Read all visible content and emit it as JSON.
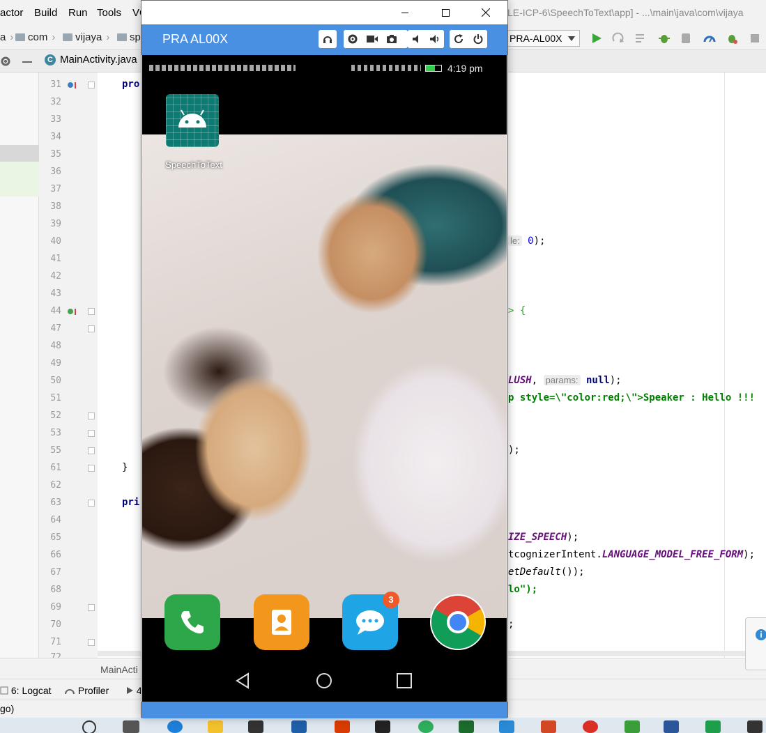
{
  "ide": {
    "menu": [
      "actor",
      "Build",
      "Run",
      "Tools",
      "VC"
    ],
    "title_fragment": "LE-ICP-6\\SpeechToText\\app] - ...\\main\\java\\com\\vijaya",
    "breadcrumb": [
      "a",
      "com",
      "vijaya",
      "sp"
    ],
    "device_selector": "PRA-AL00X",
    "file_tab": "MainActivity.java",
    "bottom_tab": "MainActi",
    "tool_windows": [
      "6: Logcat",
      "Profiler",
      "4"
    ],
    "status_text": "go)",
    "line_numbers": [
      "31",
      "32",
      "33",
      "34",
      "35",
      "36",
      "37",
      "38",
      "39",
      "40",
      "41",
      "42",
      "43",
      "44",
      "47",
      "48",
      "49",
      "50",
      "51",
      "52",
      "53",
      "55",
      "61",
      "62",
      "63",
      "64",
      "65",
      "66",
      "67",
      "68",
      "69",
      "70",
      "71",
      "72"
    ],
    "code": {
      "l31": "pro",
      "l40_hint": "le:",
      "l40_val": "0",
      "l40_end": ");",
      "l44": "> {",
      "l50_const": "LUSH",
      "l50_hint": "params:",
      "l50_null": "null",
      "l50_end": ");",
      "l51": "p style=\\\"color:red;\\\">Speaker : Hello !!!",
      "l55": ");",
      "l61": "}",
      "l63": "pri",
      "l65_const": "IZE_SPEECH",
      "l65_end": ");",
      "l66_a": "tcognizerIntent.",
      "l66_b": "LANGUAGE_MODEL_FREE_FORM",
      "l66_c": ");",
      "l67_a": "etDefault",
      "l67_b": "());",
      "l68": "lo\");",
      "l70": ";"
    }
  },
  "emulator": {
    "device_name": "PRA AL00X",
    "status_time": "4:19 pm",
    "app_label": "SpeechToText",
    "message_badge": "3",
    "accent_color": "#4a90e2"
  }
}
